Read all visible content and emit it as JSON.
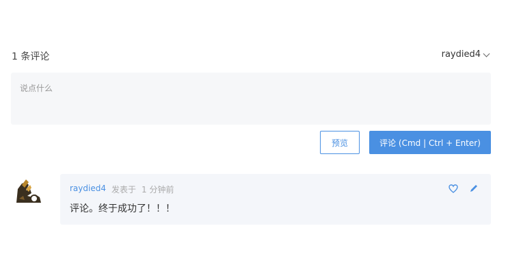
{
  "header": {
    "comments_count": "1 条评论",
    "username": "raydied4"
  },
  "composer": {
    "placeholder": "说点什么"
  },
  "actions": {
    "preview_label": "预览",
    "submit_label": "评论 (Cmd | Ctrl + Enter)"
  },
  "comment": {
    "author": "raydied4",
    "action": "发表于",
    "time": "1 分钟前",
    "body": "评论。终于成功了！！！"
  },
  "colors": {
    "accent": "#4a90e2",
    "card_bg": "#f4f6fa",
    "composer_bg": "#f6f7f9"
  },
  "icons": {
    "chevron": "chevron-down-icon",
    "like": "heart-icon",
    "edit": "pencil-icon",
    "avatar": "avatar-image"
  }
}
